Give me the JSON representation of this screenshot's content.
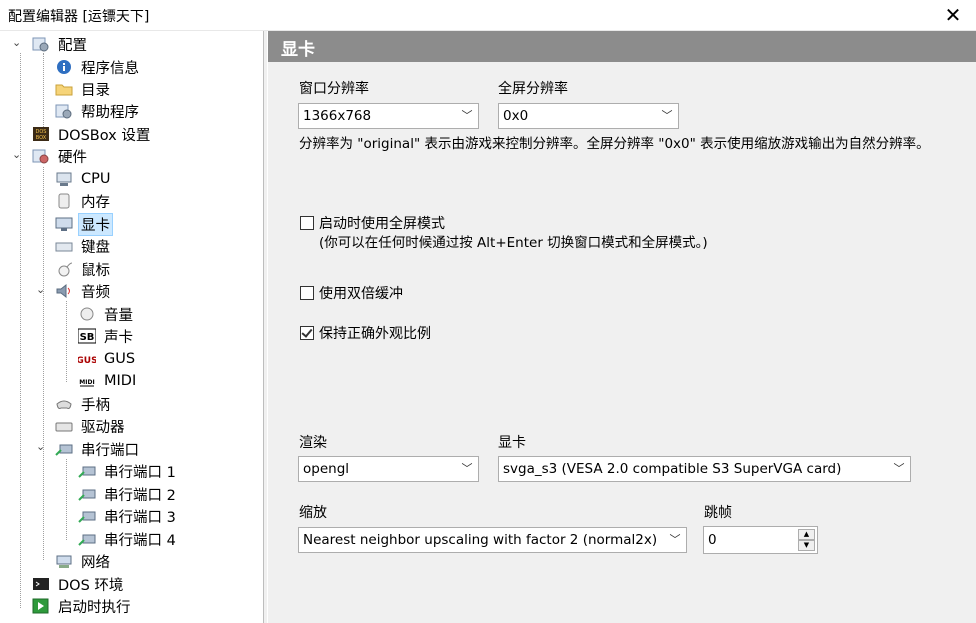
{
  "window": {
    "title": "配置编辑器 [运镖天下]",
    "close_glyph": "✕"
  },
  "tree": {
    "root": "配置",
    "program_info": "程序信息",
    "directory": "目录",
    "helper": "帮助程序",
    "dosbox_settings": "DOSBox 设置",
    "hardware": "硬件",
    "cpu": "CPU",
    "memory": "内存",
    "graphics": "显卡",
    "keyboard": "键盘",
    "mouse": "鼠标",
    "audio": "音频",
    "volume": "音量",
    "sound_card": "声卡",
    "gus": "GUS",
    "midi": "MIDI",
    "joystick": "手柄",
    "drives": "驱动器",
    "serial": "串行端口",
    "serial_1": "串行端口 1",
    "serial_2": "串行端口 2",
    "serial_3": "串行端口 3",
    "serial_4": "串行端口 4",
    "network": "网络",
    "dos_env": "DOS 环境",
    "autoexec": "启动时执行",
    "icons": {
      "dosbox_logo_text": "DOS\nBOX",
      "sb_logo_text": "SB",
      "gus_logo_text": "GUS",
      "midi_logo_text": "MIDI"
    }
  },
  "panel": {
    "header": "显卡",
    "window_res_label": "窗口分辨率",
    "window_res_value": "1366x768",
    "fullscreen_res_label": "全屏分辨率",
    "fullscreen_res_value": "0x0",
    "res_desc": "分辨率为 \"original\" 表示由游戏来控制分辨率。全屏分辨率 \"0x0\" 表示使用缩放游戏输出为自然分辨率。",
    "fullscreen_start_label": "启动时使用全屏模式",
    "fullscreen_start_checked": false,
    "fullscreen_hint": "(你可以在任何时候通过按 Alt+Enter 切换窗口模式和全屏模式。)",
    "double_buffer_label": "使用双倍缓冲",
    "double_buffer_checked": false,
    "aspect_label": "保持正确外观比例",
    "aspect_checked": true,
    "render_label": "渲染",
    "render_value": "opengl",
    "card_label": "显卡",
    "card_value": "svga_s3 (VESA 2.0 compatible S3 SuperVGA card)",
    "scale_label": "缩放",
    "scale_value": "Nearest neighbor upscaling with factor 2 (normal2x)",
    "frameskip_label": "跳帧",
    "frameskip_value": "0"
  }
}
